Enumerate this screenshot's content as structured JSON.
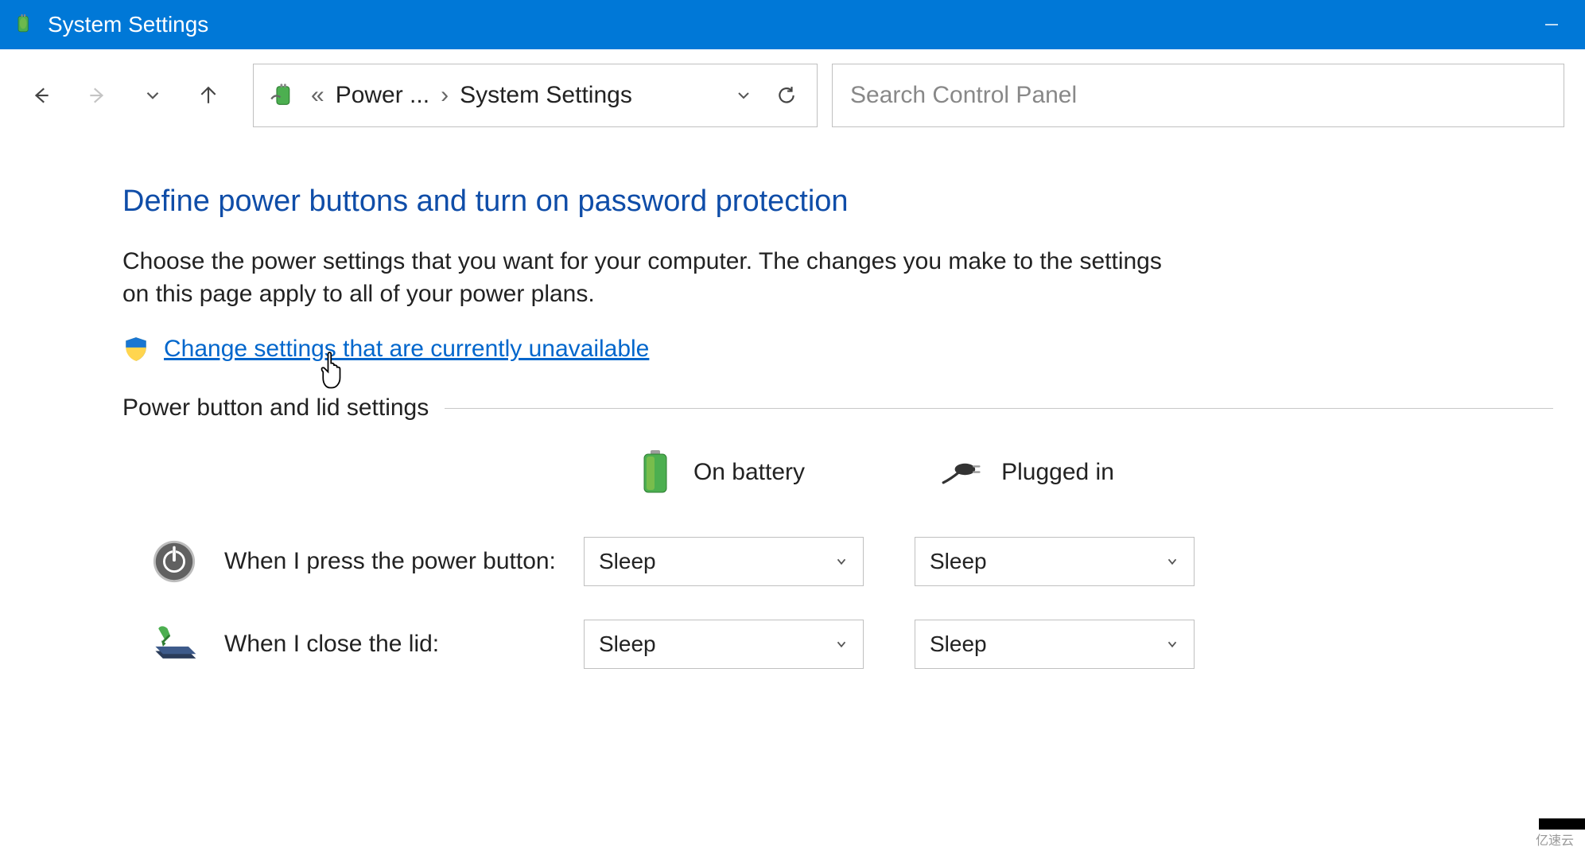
{
  "window": {
    "title": "System Settings"
  },
  "toolbar": {
    "breadcrumb": {
      "root_truncated": "Power ...",
      "separator": "›",
      "current": "System Settings",
      "chevrons": "«"
    },
    "search_placeholder": "Search Control Panel"
  },
  "page": {
    "title": "Define power buttons and turn on password protection",
    "description": "Choose the power settings that you want for your computer. The changes you make to the settings on this page apply to all of your power plans.",
    "admin_link": "Change settings that are currently unavailable",
    "group_label": "Power button and lid settings",
    "columns": {
      "battery": "On battery",
      "plugged": "Plugged in"
    },
    "rows": [
      {
        "label": "When I press the power button:",
        "battery_value": "Sleep",
        "plugged_value": "Sleep"
      },
      {
        "label": "When I close the lid:",
        "battery_value": "Sleep",
        "plugged_value": "Sleep"
      }
    ]
  },
  "watermark": "亿速云"
}
